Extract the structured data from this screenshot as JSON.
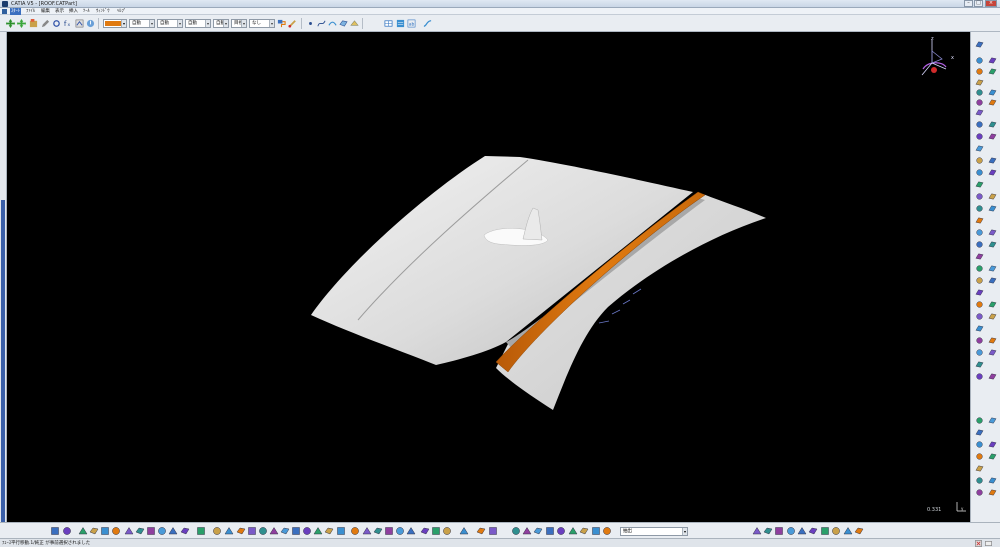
{
  "window": {
    "title": "CATIA V5 - [ROOF.CATPart]",
    "controls": {
      "minimize": "–",
      "maximize": "□",
      "close": "×"
    }
  },
  "menubar": {
    "items": [
      {
        "label": "ｽﾀｰﾄ"
      },
      {
        "label": "ﾌｧｲﾙ"
      },
      {
        "label": "編集"
      },
      {
        "label": "表示"
      },
      {
        "label": "挿入"
      },
      {
        "label": "ﾂｰﾙ"
      },
      {
        "label": "ｳｨﾝﾄﾞｳ"
      },
      {
        "label": "ﾍﾙﾌﾟ"
      }
    ]
  },
  "toolbar_top": {
    "color_value": "#e07a10",
    "linetype_value": "自動",
    "thickness_value": "自動",
    "linestyle_value": "自動",
    "layer_value": "自動",
    "pointstyle_value": "目視",
    "rendering_value": "なし",
    "dropdown_arrow": "▾"
  },
  "toolbar_bottom": {
    "command_input_value": "抽出",
    "dropdown_arrow": "▾"
  },
  "viewport": {
    "background": "#000000",
    "scale_readout": "0.331",
    "compass_labels": {
      "z": "z",
      "x": "x",
      "y": "y"
    },
    "part_color": "#e8e8e8",
    "highlight_color": "#e07a10"
  },
  "statusbar": {
    "message": "ﾌｪｰｽ平行移動.1/純正 が事前選択されました"
  },
  "icons": [
    "catia-logo-icon",
    "pan-icon",
    "rotate-icon",
    "zoom-icon",
    "normal-view-icon",
    "fit-all-icon",
    "measure-icon",
    "compass-icon",
    "sketch-icon",
    "extrude-icon",
    "save-icon",
    "new-icon",
    "open-icon",
    "print-icon",
    "undo-icon",
    "redo-icon",
    "help-icon"
  ]
}
